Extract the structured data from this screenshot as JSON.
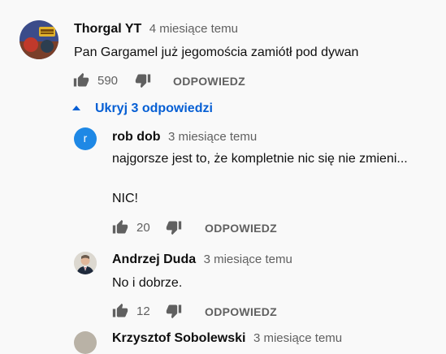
{
  "colors": {
    "accent": "#065fd4",
    "secondary_text": "#606060",
    "avatar_r": "#1e88e5"
  },
  "comment": {
    "author": "Thorgal YT",
    "time": "4 miesiące temu",
    "text": "Pan Gargamel już jegomościa zamiótł pod dywan",
    "likes": "590",
    "reply_label": "ODPOWIEDZ",
    "avatar_icon": "game-avatar-icon"
  },
  "replies_toggle": {
    "label": "Ukryj 3 odpowiedzi",
    "icon": "chevron-up-icon"
  },
  "replies": [
    {
      "author": "rob dob",
      "time": "3 miesiące temu",
      "text_line1": "najgorsze jest to, że kompletnie nic się nie zmieni...",
      "text_line2": "NIC!",
      "likes": "20",
      "reply_label": "ODPOWIEDZ",
      "avatar_letter": "r"
    },
    {
      "author": "Andrzej Duda",
      "time": "3 miesiące temu",
      "text": "No i dobrze.",
      "likes": "12",
      "reply_label": "ODPOWIEDZ",
      "avatar_icon": "person-avatar-icon"
    },
    {
      "author": "Krzysztof Sobolewski",
      "time": "3 miesiące temu"
    }
  ]
}
